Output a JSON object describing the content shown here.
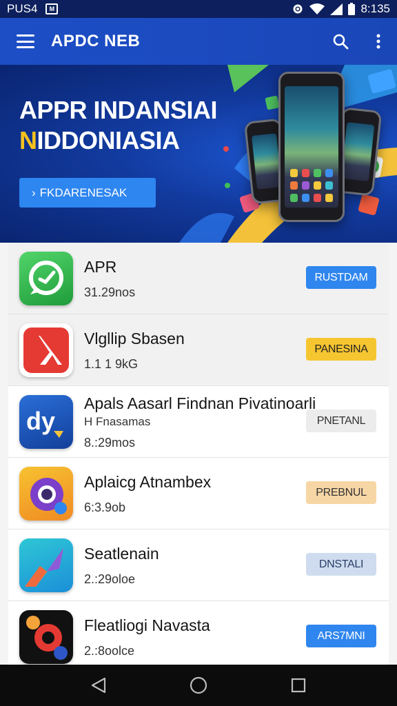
{
  "status_bar": {
    "left_text": "PUS4",
    "left_badge": "M",
    "time": "8:135",
    "icons": [
      "settings-icon",
      "wifi-icon",
      "signal-icon",
      "battery-icon"
    ]
  },
  "app_bar": {
    "title": "APDC NEB",
    "icons": [
      "menu-icon",
      "search-icon",
      "more-vert-icon"
    ]
  },
  "banner": {
    "title_line1": "APPR INDANSIAI",
    "title_line2_accent": "N",
    "title_line2": "IDDONIASIA",
    "cta_label": "FKDARENESAK",
    "cta_chevron": "›"
  },
  "apps": [
    {
      "name": "APR",
      "subtitle": "",
      "meta": "31.29nos",
      "button": "RUSTDAM",
      "icon": "chat-bubble-icon",
      "button_bg": "#2f86ee",
      "button_fg": "#ffffff"
    },
    {
      "name": "Vlgllip Sbasen",
      "subtitle": "",
      "meta": "1.1 1 9kG",
      "button": "PANESINA",
      "icon": "lambda-icon",
      "button_bg": "#f6c631",
      "button_fg": "#222222"
    },
    {
      "name": "Apals Aasarl Findnan Pivatinoarli",
      "subtitle": "H Fnasamas",
      "meta": "8.:29mos",
      "button": "PNETANL",
      "icon": "dy-logo-icon",
      "button_bg": "#ececec",
      "button_fg": "#333333"
    },
    {
      "name": "Aplaicg Atnambex",
      "subtitle": "",
      "meta": "6:3.9ob",
      "button": "PREBNUL",
      "icon": "lens-icon",
      "button_bg": "#f7d6a5",
      "button_fg": "#333333"
    },
    {
      "name": "Seatlenain",
      "subtitle": "",
      "meta": "2.:29oloe",
      "button": "DNSTALI",
      "icon": "arrow-icon",
      "button_bg": "#cfdcef",
      "button_fg": "#2a3d66"
    },
    {
      "name": "Fleatliogi Navasta",
      "subtitle": "",
      "meta": "2.:8oolce",
      "button": "ARS7MNI",
      "icon": "gear-icon",
      "button_bg": "#2f86ee",
      "button_fg": "#ffffff"
    }
  ],
  "nav_bar": {
    "buttons": [
      "back-icon",
      "home-icon",
      "recents-icon"
    ]
  },
  "colors": {
    "app_bar": "#1d4ec6",
    "status_bar": "#0d1f5c",
    "accent_yellow": "#f6c21c",
    "cta_blue": "#2e86f0"
  }
}
